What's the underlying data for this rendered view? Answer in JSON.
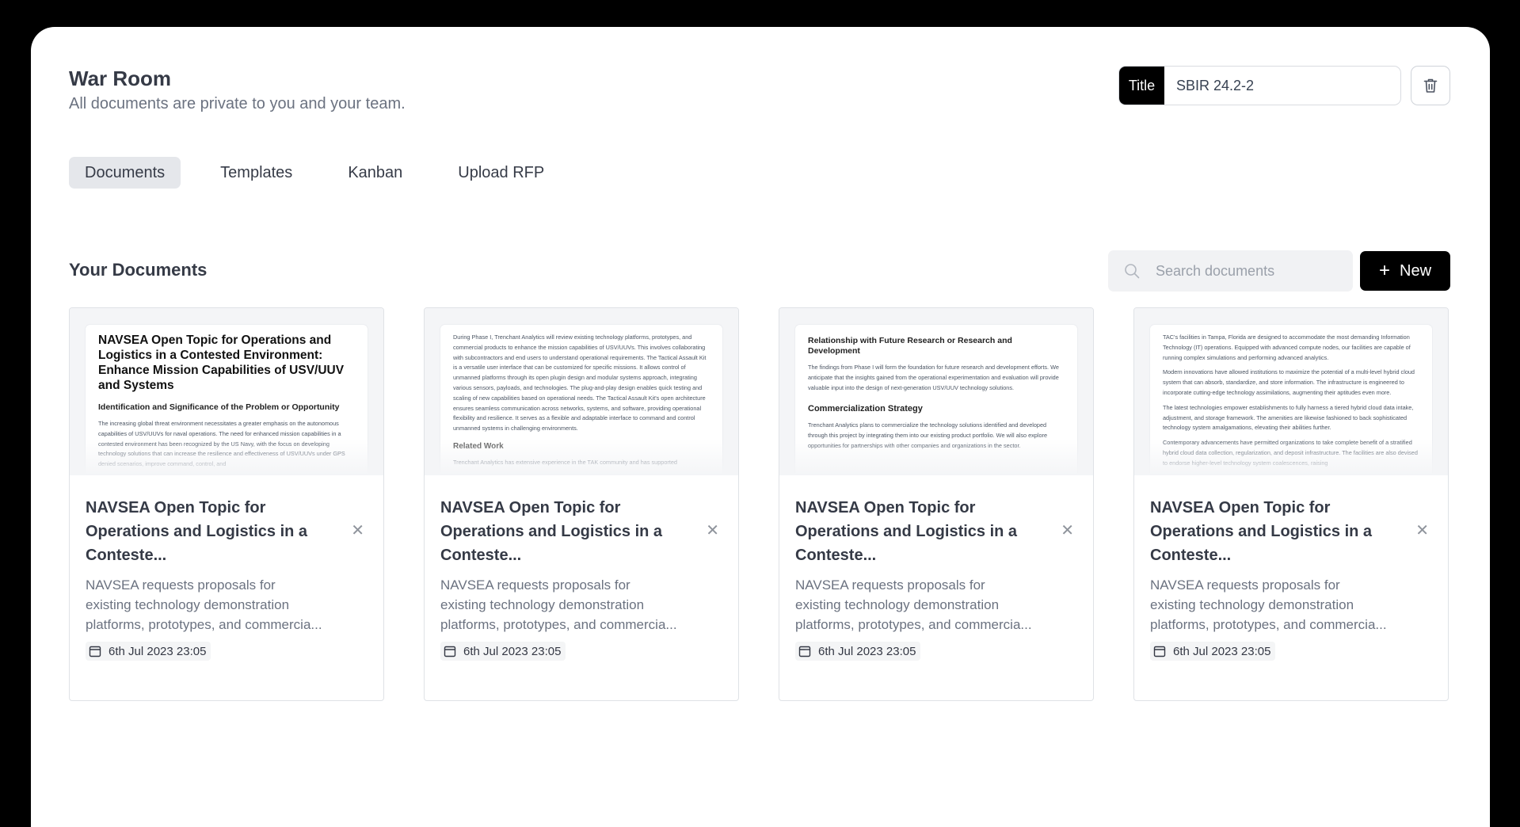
{
  "header": {
    "title": "War Room",
    "subtitle": "All documents are private to you and your team.",
    "title_field_tag": "Title",
    "title_field_value": "SBIR 24.2-2"
  },
  "tabs": [
    {
      "label": "Documents",
      "active": true
    },
    {
      "label": "Templates",
      "active": false
    },
    {
      "label": "Kanban",
      "active": false
    },
    {
      "label": "Upload RFP",
      "active": false
    }
  ],
  "documents_section": {
    "title": "Your Documents",
    "search_placeholder": "Search documents",
    "new_button_label": "New"
  },
  "cards": [
    {
      "title": "NAVSEA Open Topic for Operations and Logistics in a Conteste...",
      "description": "NAVSEA requests proposals for existing technology demonstration platforms, prototypes, and commercia...",
      "date": "6th Jul 2023 23:05",
      "preview": {
        "heading": "NAVSEA Open Topic for Operations and Logistics in a Contested Environment: Enhance Mission Capabilities of USV/UUV and Systems",
        "subheading": "Identification and Significance of the Problem or Opportunity",
        "text": "The increasing global threat environment necessitates a greater emphasis on the autonomous capabilities of USV/UUVs for naval operations. The need for enhanced mission capabilities in a contested environment has been recognized by the US Navy, with the focus on developing technology solutions that can increase the resilience and effectiveness of USV/UUVs under GPS denied scenarios, improve command, control, and"
      }
    },
    {
      "title": "NAVSEA Open Topic for Operations and Logistics in a Conteste...",
      "description": "NAVSEA requests proposals for existing technology demonstration platforms, prototypes, and commercia...",
      "date": "6th Jul 2023 23:05",
      "preview": {
        "text": "During Phase I, Trenchant Analytics will review existing technology platforms, prototypes, and commercial products to enhance the mission capabilities of USV/UUVs. This involves collaborating with subcontractors and end users to understand operational requirements. The Tactical Assault Kit is a versatile user interface that can be customized for specific missions. It allows control of unmanned platforms through its open plugin design and modular systems approach, integrating various sensors, payloads, and technologies. The plug-and-play design enables quick testing and scaling of new capabilities based on operational needs. The Tactical Assault Kit's open architecture ensures seamless communication across networks, systems, and software, providing operational flexibility and resilience. It serves as a flexible and adaptable interface to command and control unmanned systems in challenging environments.",
        "subheading": "Related Work",
        "text2": "Trenchant Analytics has extensive experience in the TAK community and has supported"
      }
    },
    {
      "title": "NAVSEA Open Topic for Operations and Logistics in a Conteste...",
      "description": "NAVSEA requests proposals for existing technology demonstration platforms, prototypes, and commercia...",
      "date": "6th Jul 2023 23:05",
      "preview": {
        "heading": "Relationship with Future Research or Research and Development",
        "text": "The findings from Phase I will form the foundation for future research and development efforts. We anticipate that the insights gained from the operational experimentation and evaluation will provide valuable input into the design of next-generation USV/UUV technology solutions.",
        "subheading": "Commercialization Strategy",
        "text2": "Trenchant Analytics plans to commercialize the technology solutions identified and developed through this project by integrating them into our existing product portfolio. We will also explore opportunities for partnerships with other companies and organizations in the sector."
      }
    },
    {
      "title": "NAVSEA Open Topic for Operations and Logistics in a Conteste...",
      "description": "NAVSEA requests proposals for existing technology demonstration platforms, prototypes, and commercia...",
      "date": "6th Jul 2023 23:05",
      "preview": {
        "text": "TAC's facilities in Tampa, Florida are designed to accommodate the most demanding Information Technology (IT) operations. Equipped with advanced compute nodes, our facilities are capable of running complex simulations and performing advanced analytics.",
        "text2": "Modern innovations have allowed institutions to maximize the potential of a multi-level hybrid cloud system that can absorb, standardize, and store information. The infrastructure is engineered to incorporate cutting-edge technology assimilations, augmenting their aptitudes even more.",
        "text3": "The latest technologies empower establishments to fully harness a tiered hybrid cloud data intake, adjustment, and storage framework. The amenities are likewise fashioned to back sophisticated technology system amalgamations, elevating their abilities further.",
        "text4": "Contemporary advancements have permitted organizations to take complete benefit of a stratified hybrid cloud data collection, regularization, and deposit infrastructure. The facilities are also devised to endorse higher-level technology system coalescences, raising"
      }
    }
  ]
}
